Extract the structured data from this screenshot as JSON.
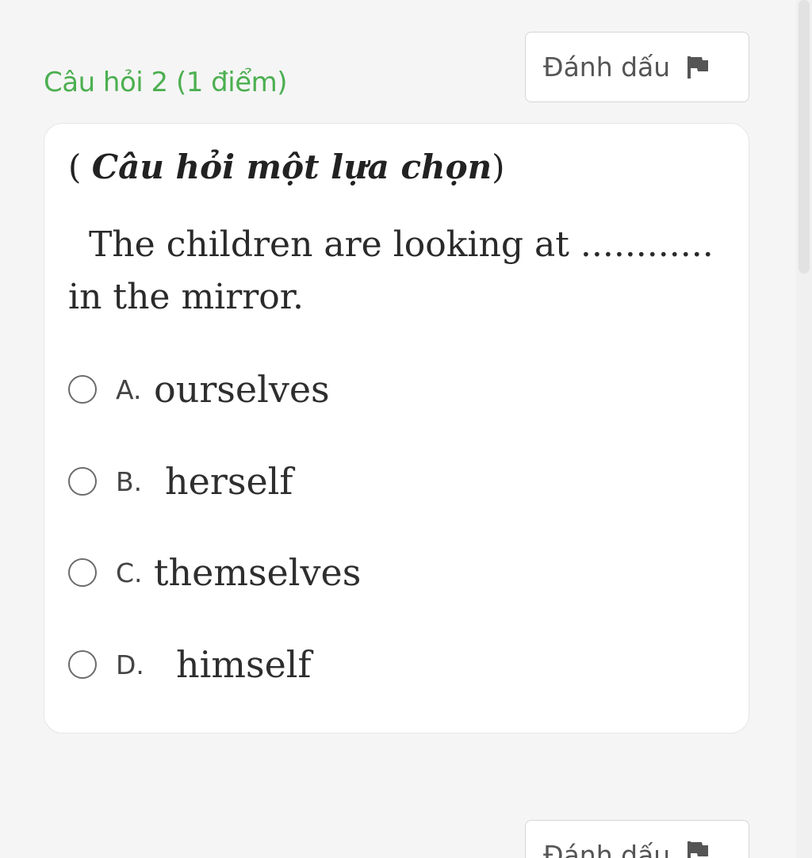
{
  "question": {
    "title": "Câu hỏi 2 (1 điểm)",
    "flag_label": "Đánh dấu",
    "type_open": "(",
    "type_text": "Câu hỏi một lựa chọn",
    "type_close": ")",
    "text": "The children are looking at ............ in the mirror.",
    "options": [
      {
        "letter": "A.",
        "text": "ourselves"
      },
      {
        "letter": "B.",
        "text": "herself"
      },
      {
        "letter": "C.",
        "text": "themselves"
      },
      {
        "letter": "D.",
        "text": "himself"
      }
    ]
  },
  "next_question": {
    "flag_label": "Đánh dấu"
  },
  "colors": {
    "title_green": "#4caf50",
    "background": "#f5f5f5"
  },
  "icons": {
    "flag": "flag-icon"
  }
}
